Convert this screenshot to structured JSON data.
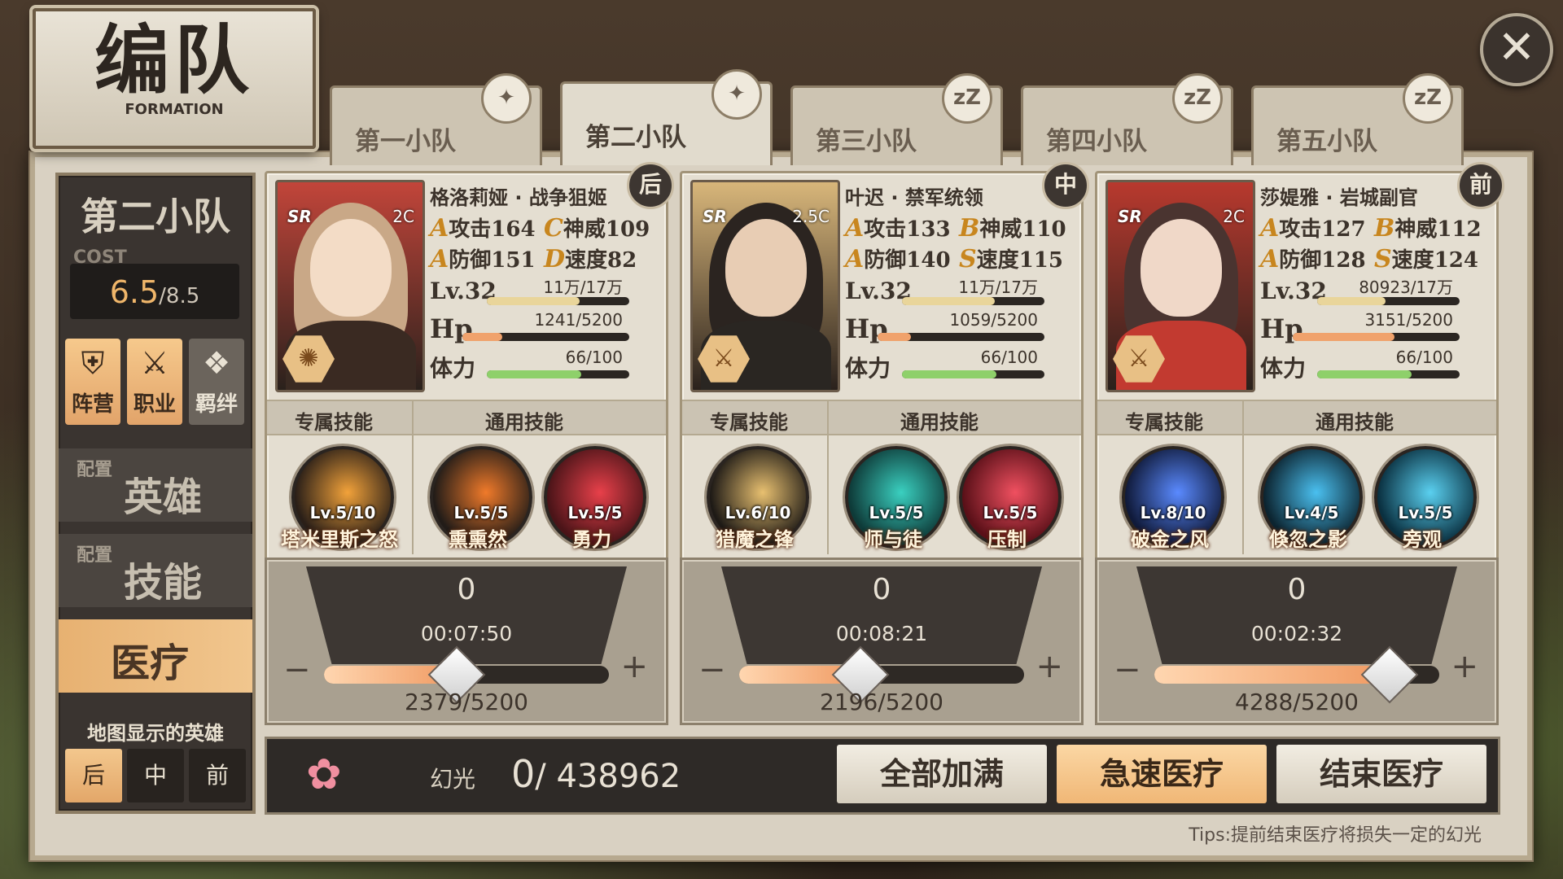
{
  "title": {
    "cn": "编队",
    "en": "FORMATION"
  },
  "close_label": "✕",
  "tabs": [
    {
      "label": "第一小队",
      "badge": "✦"
    },
    {
      "label": "第二小队",
      "badge": "✦"
    },
    {
      "label": "第三小队",
      "badge": "zZ"
    },
    {
      "label": "第四小队",
      "badge": "zZ"
    },
    {
      "label": "第五小队",
      "badge": "zZ"
    }
  ],
  "sidebar": {
    "team_name": "第二小队",
    "cost_label": "COST",
    "cost_current": "6.5",
    "cost_max": "/8.5",
    "icons": [
      {
        "label": "阵营",
        "icon": "faction-shield-icon",
        "glyph": "⛨"
      },
      {
        "label": "职业",
        "icon": "sword-icon",
        "glyph": "⚔"
      },
      {
        "label": "羁绊",
        "icon": "handshake-icon",
        "glyph": "❖"
      }
    ],
    "menu": [
      {
        "small": "配置",
        "big": "英雄"
      },
      {
        "small": "配置",
        "big": "技能"
      },
      {
        "small": "",
        "big": "医疗"
      }
    ],
    "map_label": "地图显示的英雄",
    "positions": [
      "后",
      "中",
      "前"
    ]
  },
  "heroes": [
    {
      "name": "格洛莉娅 · 战争狙姬",
      "rarity": "SR",
      "cost": "2C",
      "position": "后",
      "class_icon": "gear-hex-icon",
      "class_glyph": "✺",
      "stats": [
        {
          "grade": "A",
          "label": "攻击",
          "value": "164"
        },
        {
          "grade": "C",
          "label": "神威",
          "value": "109"
        },
        {
          "grade": "A",
          "label": "防御",
          "value": "151"
        },
        {
          "grade": "D",
          "label": "速度",
          "value": "82"
        }
      ],
      "level": "Lv.32",
      "exp": "11万/17万",
      "exp_ratio": 0.65,
      "hp_label": "Hp",
      "hp": "1241/5200",
      "hp_ratio": 0.24,
      "stamina_label": "体力",
      "stamina": "66/100",
      "stamina_ratio": 0.66,
      "skill_head_exclusive": "专属技能",
      "skill_head_general": "通用技能",
      "skills": [
        {
          "lv": "Lv.5/10",
          "name": "塔米里斯之怒",
          "color1": "#f2a23a",
          "color2": "#2a1f18"
        },
        {
          "lv": "Lv.5/5",
          "name": "熏熏然",
          "color1": "#f07a2a",
          "color2": "#221c18"
        },
        {
          "lv": "Lv.5/5",
          "name": "勇力",
          "color1": "#e8404a",
          "color2": "#4a1418"
        }
      ],
      "heal": {
        "count": "0",
        "time": "00:07:50",
        "hp": "2379/5200",
        "ratio": 0.46
      },
      "palette": {
        "bg": "#c2453a",
        "hair": "#c9a887",
        "face": "#f3dcc6",
        "body": "#3a2a22"
      }
    },
    {
      "name": "叶迟 · 禁军统领",
      "rarity": "SR",
      "cost": "2.5C",
      "position": "中",
      "class_icon": "crossed-swords-icon",
      "class_glyph": "⚔",
      "stats": [
        {
          "grade": "A",
          "label": "攻击",
          "value": "133"
        },
        {
          "grade": "B",
          "label": "神威",
          "value": "110"
        },
        {
          "grade": "A",
          "label": "防御",
          "value": "140"
        },
        {
          "grade": "S",
          "label": "速度",
          "value": "115"
        }
      ],
      "level": "Lv.32",
      "exp": "11万/17万",
      "exp_ratio": 0.65,
      "hp_label": "Hp",
      "hp": "1059/5200",
      "hp_ratio": 0.2,
      "stamina_label": "体力",
      "stamina": "66/100",
      "stamina_ratio": 0.66,
      "skill_head_exclusive": "专属技能",
      "skill_head_general": "通用技能",
      "skills": [
        {
          "lv": "Lv.6/10",
          "name": "猎魔之锋",
          "color1": "#e8c070",
          "color2": "#1e1a16"
        },
        {
          "lv": "Lv.5/5",
          "name": "师与徒",
          "color1": "#3ad0c0",
          "color2": "#0e3a38"
        },
        {
          "lv": "Lv.5/5",
          "name": "压制",
          "color1": "#f05060",
          "color2": "#5a1018"
        }
      ],
      "heal": {
        "count": "0",
        "time": "00:08:21",
        "hp": "2196/5200",
        "ratio": 0.42
      },
      "palette": {
        "bg": "#d8b67a",
        "hair": "#2b2420",
        "face": "#e8cdb4",
        "body": "#2a2622"
      }
    },
    {
      "name": "莎媞雅 · 岩城副官",
      "rarity": "SR",
      "cost": "2C",
      "position": "前",
      "class_icon": "crossed-swords-icon",
      "class_glyph": "⚔",
      "stats": [
        {
          "grade": "A",
          "label": "攻击",
          "value": "127"
        },
        {
          "grade": "B",
          "label": "神威",
          "value": "112"
        },
        {
          "grade": "A",
          "label": "防御",
          "value": "128"
        },
        {
          "grade": "S",
          "label": "速度",
          "value": "124"
        }
      ],
      "level": "Lv.32",
      "exp": "80923/17万",
      "exp_ratio": 0.48,
      "hp_label": "Hp",
      "hp": "3151/5200",
      "hp_ratio": 0.61,
      "stamina_label": "体力",
      "stamina": "66/100",
      "stamina_ratio": 0.66,
      "skill_head_exclusive": "专属技能",
      "skill_head_general": "通用技能",
      "skills": [
        {
          "lv": "Lv.8/10",
          "name": "破金之风",
          "color1": "#5a8aff",
          "color2": "#101a3a"
        },
        {
          "lv": "Lv.4/5",
          "name": "倏忽之影",
          "color1": "#4ac0f0",
          "color2": "#0c2430"
        },
        {
          "lv": "Lv.5/5",
          "name": "旁观",
          "color1": "#5ad0f0",
          "color2": "#0a3040"
        }
      ],
      "heal": {
        "count": "0",
        "time": "00:02:32",
        "hp": "4288/5200",
        "ratio": 0.82
      },
      "palette": {
        "bg": "#b8392e",
        "hair": "#4a3430",
        "face": "#f0d8c8",
        "body": "#c23a30"
      }
    }
  ],
  "bottom": {
    "currency_icon": "lotus-flower-icon",
    "currency_label": "幻光",
    "currency_current": "0",
    "currency_total": "/ 438962",
    "btn_fill": "全部加满",
    "btn_rush": "急速医疗",
    "btn_end": "结束医疗"
  },
  "tips": "Tips:提前结束医疗将损失一定的幻光",
  "colors": {
    "exp_bar": "#e9d59a",
    "hp_bar": "#f0a26c",
    "stamina_bar": "#8ed06a"
  }
}
